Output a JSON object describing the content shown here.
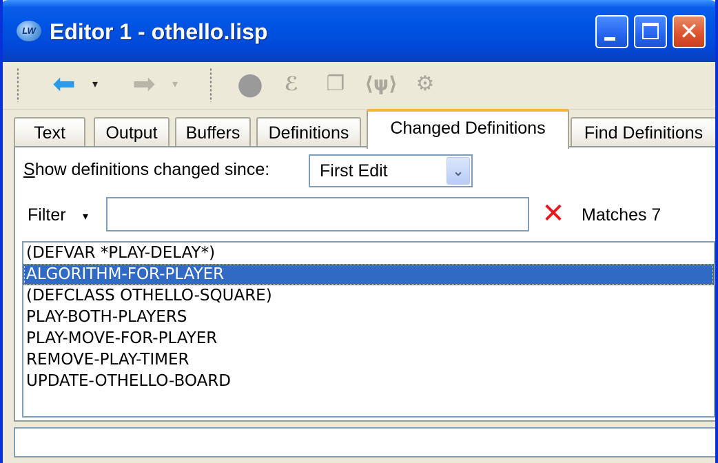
{
  "window": {
    "app_icon": "lw-app-icon",
    "title": "Editor 1 - othello.lisp",
    "controls": {
      "minimize_icon": "minimize-icon",
      "maximize_icon": "maximize-icon",
      "close_icon": "close-icon"
    }
  },
  "toolbar": {
    "icons": [
      "back-arrow-icon",
      "back-dropdown-icon",
      "forward-arrow-icon",
      "forward-dropdown-icon",
      "stop-icon",
      "evaluate-icon",
      "compile-icon",
      "trace-icon",
      "debug-icon"
    ]
  },
  "tabs": [
    {
      "label": "Text",
      "active": false
    },
    {
      "label": "Output",
      "active": false
    },
    {
      "label": "Buffers",
      "active": false
    },
    {
      "label": "Definitions",
      "active": false
    },
    {
      "label": "Changed Definitions",
      "active": true
    },
    {
      "label": "Find Definitions",
      "active": false
    }
  ],
  "changed_definitions": {
    "since_label_mnemonic": "S",
    "since_label_rest": "how definitions changed since:",
    "since_value": "First Edit",
    "filter_label": "Filter",
    "filter_value": "",
    "matches_text": "Matches 7",
    "definitions": [
      {
        "text": "(DEFVAR *PLAY-DELAY*)",
        "selected": false
      },
      {
        "text": "ALGORITHM-FOR-PLAYER",
        "selected": true
      },
      {
        "text": "(DEFCLASS OTHELLO-SQUARE)",
        "selected": false
      },
      {
        "text": "PLAY-BOTH-PLAYERS",
        "selected": false
      },
      {
        "text": "PLAY-MOVE-FOR-PLAYER",
        "selected": false
      },
      {
        "text": "REMOVE-PLAY-TIMER",
        "selected": false
      },
      {
        "text": "UPDATE-OTHELLO-BOARD",
        "selected": false
      }
    ]
  },
  "status_bar": {
    "text": ""
  },
  "colors": {
    "title_bar": "#0054e3",
    "selection": "#316ac5",
    "active_tab_accent": "#f3b33d",
    "clear_icon": "#e8141c"
  }
}
